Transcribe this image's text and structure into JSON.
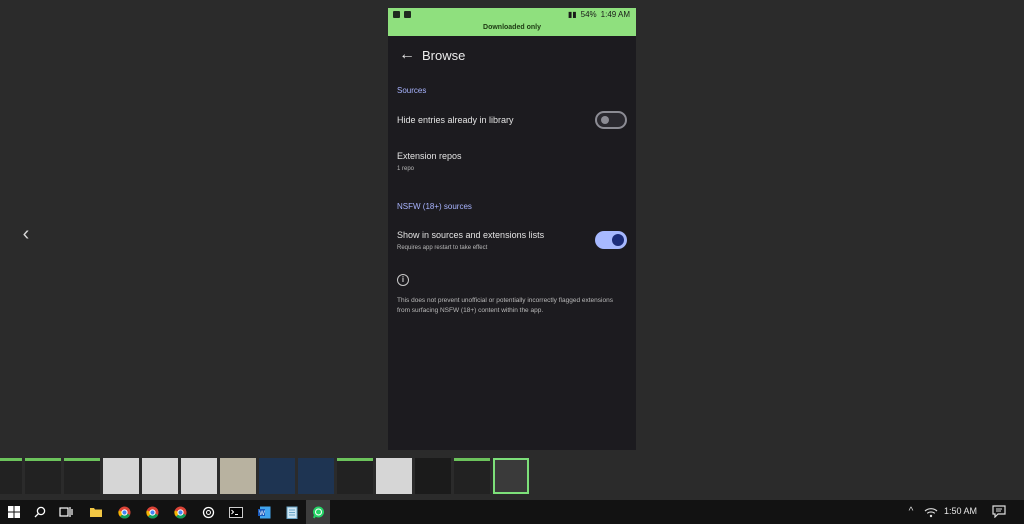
{
  "viewer": {
    "prev_arrow": "‹"
  },
  "phone": {
    "status": {
      "battery": "54%",
      "time": "1:49 AM"
    },
    "banner": "Downloaded only",
    "appbar": {
      "back": "←",
      "title": "Browse"
    },
    "sections": {
      "sources": {
        "header": "Sources",
        "hide_entries": {
          "label": "Hide entries already in library",
          "enabled": false
        },
        "extension_repos": {
          "label": "Extension repos",
          "summary": "1 repo"
        }
      },
      "nsfw": {
        "header": "NSFW (18+) sources",
        "show_in_lists": {
          "label": "Show in sources and extensions lists",
          "summary": "Requires app restart to take effect",
          "enabled": true
        },
        "info_icon": "i",
        "info_text": "This does not prevent unofficial or potentially incorrectly flagged extensions from surfacing NSFW (18+) content within the app."
      }
    }
  },
  "taskbar": {
    "clock": "1:50 AM",
    "tray_caret": "^"
  },
  "colors": {
    "accent_green": "#8fe07e",
    "section_blue": "#a8b4ff",
    "toggle_on": "#a7b9ff",
    "taskbar_bg": "#121212"
  },
  "icons": [
    "windows-start-icon",
    "search-icon",
    "task-view-icon",
    "file-explorer-icon",
    "chrome-icon",
    "chrome-icon",
    "chrome-icon",
    "chatgpt-icon",
    "terminal-icon",
    "word-icon",
    "notepad-icon",
    "whatsapp-icon",
    "wifi-icon",
    "notification-icon"
  ]
}
